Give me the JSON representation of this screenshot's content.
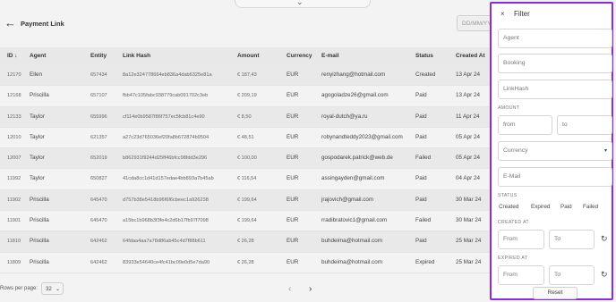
{
  "header": {
    "title": "Payment Link",
    "date_placeholder": "DD/MM/YY"
  },
  "table": {
    "columns": [
      "ID ↓",
      "Agent",
      "Entity",
      "Link Hash",
      "Amount",
      "Currency",
      "E-mail",
      "Status",
      "Created At"
    ],
    "rows": [
      {
        "id": "12170",
        "agent": "Ellen",
        "entity": "657434",
        "hash": "8a12e324778664eb836a4dab6325e81a",
        "amount": "€ 187,43",
        "currency": "EUR",
        "email": "renyizhang@hotmail.com",
        "status": "Created",
        "created": "13 Apr 24"
      },
      {
        "id": "12168",
        "agent": "Priscilla",
        "entity": "657107",
        "hash": "fbb47c105fabc938779cab091702c3eb",
        "amount": "€ 209,19",
        "currency": "EUR",
        "email": "agogoladze26@gmail.com",
        "status": "Paid",
        "created": "13 Apr 24"
      },
      {
        "id": "12133",
        "agent": "Taylor",
        "entity": "655996",
        "hash": "cf114e0b9587f86f757ec5fcb81c4e90",
        "amount": "€ 8,50",
        "currency": "EUR",
        "email": "royal-dutch@ya.ru",
        "status": "Paid",
        "created": "11 Apr 24"
      },
      {
        "id": "12010",
        "agent": "Taylor",
        "entity": "621357",
        "hash": "a27c23d765036ef20fa8b672874b9504",
        "amount": "€ 48,51",
        "currency": "EUR",
        "email": "robynandteddy2023@gmail.com",
        "status": "Paid",
        "created": "05 Apr 24"
      },
      {
        "id": "12007",
        "agent": "Taylor",
        "entity": "652019",
        "hash": "b862931f9244d25ff46bfcc98fdd3e296",
        "amount": "€ 100,00",
        "currency": "EUR",
        "email": "gospodarek.patrick@web.de",
        "status": "Failed",
        "created": "05 Apr 24"
      },
      {
        "id": "11992",
        "agent": "Taylor",
        "entity": "650827",
        "hash": "41cda8cc1d41d157edae4bb893a7b45ab",
        "amount": "€ 116,54",
        "currency": "EUR",
        "email": "assingayden@gmail.com",
        "status": "Paid",
        "created": "04 Apr 24"
      },
      {
        "id": "11902",
        "agent": "Priscilla",
        "entity": "645470",
        "hash": "d757b38e5418b96f6f6cbeec1a926238",
        "amount": "€ 199,64",
        "currency": "EUR",
        "email": "jrajovich@gmail.com",
        "status": "Paid",
        "created": "30 Mar 24"
      },
      {
        "id": "11901",
        "agent": "Priscilla",
        "entity": "645470",
        "hash": "a15bc1b968b3f3fe4c2d6b17fb97f7098",
        "amount": "€ 199,64",
        "currency": "EUR",
        "email": "rradibratovic1@gmail.com",
        "status": "Failed",
        "created": "30 Mar 24"
      },
      {
        "id": "11810",
        "agent": "Priscilla",
        "entity": "642462",
        "hash": "64fdaa4aa7a78d86ab45c4d7f88b611",
        "amount": "€ 26,28",
        "currency": "EUR",
        "email": "buhdeima@hotmail.com",
        "status": "Paid",
        "created": "25 Mar 24"
      },
      {
        "id": "11809",
        "agent": "Priscilla",
        "entity": "642462",
        "hash": "83933e54640ce4fc41bc09e0d5e7da90",
        "amount": "€ 26,28",
        "currency": "EUR",
        "email": "buhdeima@hotmail.com",
        "status": "Expired",
        "created": "25 Mar 24"
      }
    ]
  },
  "footer": {
    "rows_per_page_label": "Rows per page:",
    "rows_per_page_value": "32",
    "prev": "‹",
    "next": "›"
  },
  "filter": {
    "title": "Filter",
    "close": "×",
    "agent_placeholder": "Agent",
    "booking_placeholder": "Booking",
    "linkhash_placeholder": "LinkHash",
    "amount_label": "AMOUNT",
    "from_placeholder": "from",
    "to_placeholder": "to",
    "currency_placeholder": "Currency",
    "email_placeholder": "E-Mail",
    "status_label": "STATUS",
    "status_options": [
      "Created",
      "Expired",
      "Paid",
      "Failed"
    ],
    "created_label": "CREATED AT",
    "expired_label": "EXPIRED AT",
    "date_from": "From",
    "date_to": "To",
    "reset_label": "Reset"
  },
  "colors": {
    "panel_border": "#8a2be2"
  },
  "icons": {
    "back": "arrow-left-icon",
    "close": "close-icon",
    "reset_date": "refresh-icon",
    "caret": "chevron-down-icon"
  }
}
